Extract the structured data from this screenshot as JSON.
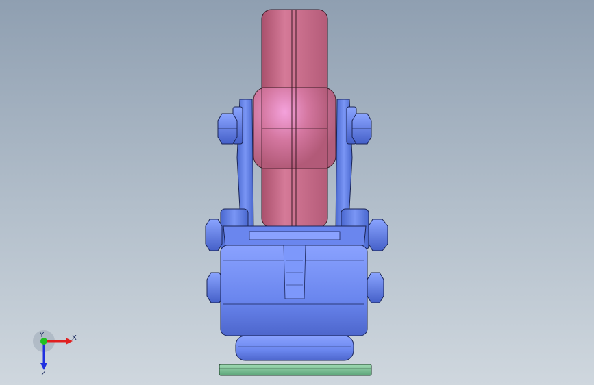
{
  "viewport": {
    "background_top": "#8f9fb1",
    "background_bottom": "#cfd7de"
  },
  "model": {
    "description_icon": "caster-wheel-3d-model",
    "colors": {
      "wheel": "#c46a86",
      "wheel_highlight": "#e58fc9",
      "fork": "#5f7fe0",
      "body": "#6e8cf0",
      "plate": "#7fc59a"
    }
  },
  "triad": {
    "x_label": "X",
    "y_label": "Y",
    "z_label": "Z",
    "x_color": "#e02020",
    "y_color": "#20c020",
    "z_color": "#2030e0"
  }
}
